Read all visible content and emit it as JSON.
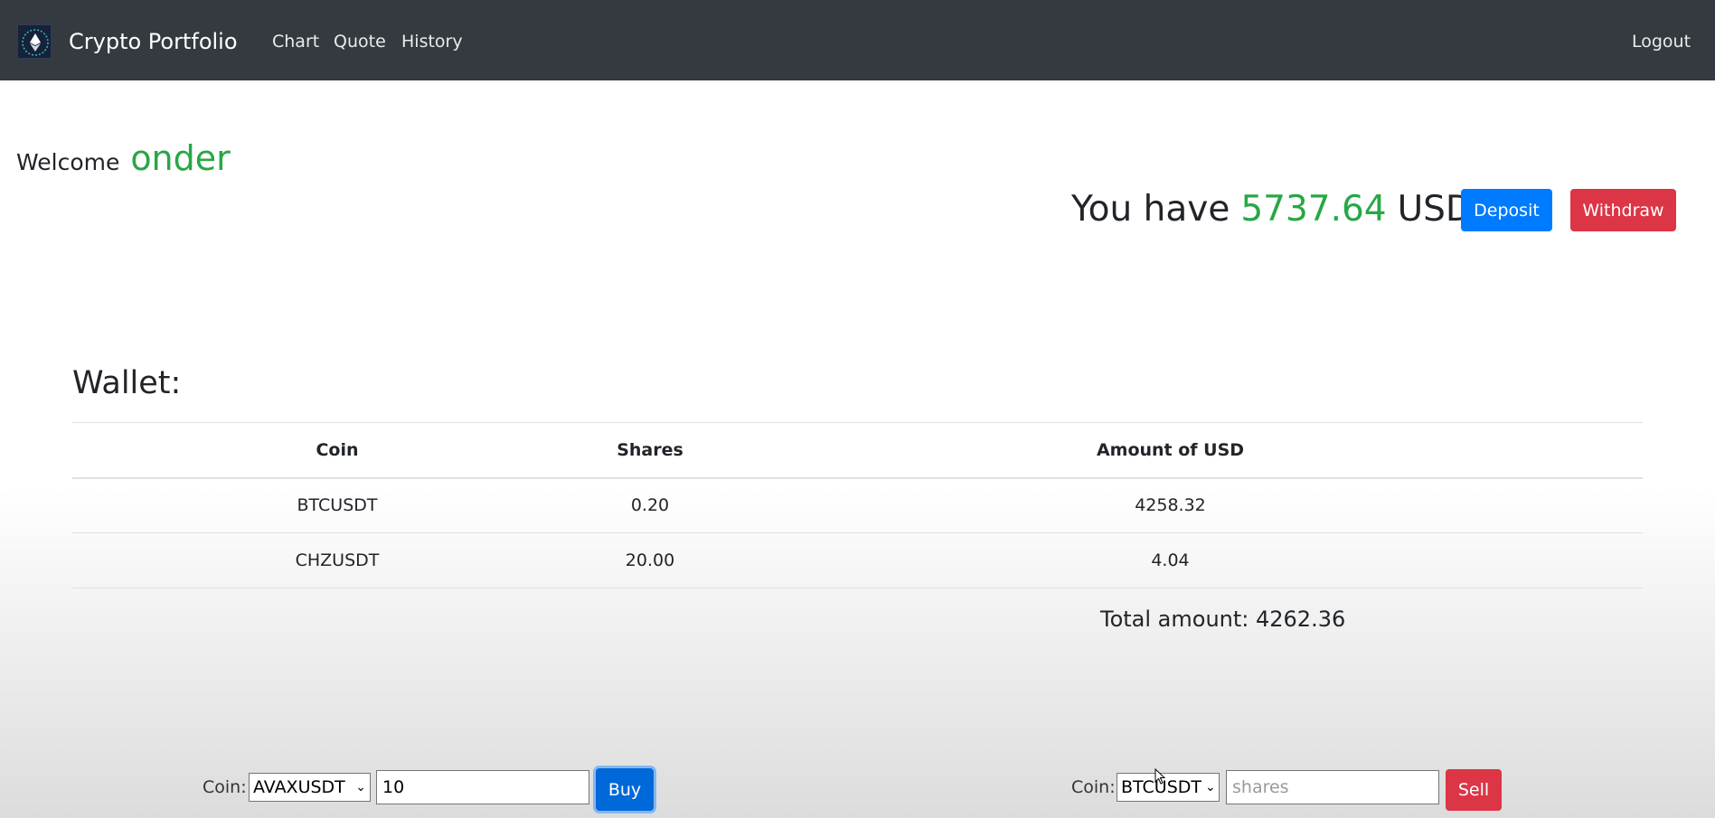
{
  "navbar": {
    "brand": "Crypto Portfolio",
    "links": {
      "chart": "Chart",
      "quote": "Quote",
      "history": "History"
    },
    "logout": "Logout"
  },
  "welcome": {
    "prefix": "Welcome",
    "username": "onder"
  },
  "balance": {
    "prefix": "You have",
    "amount": "5737.64",
    "currency": "USD"
  },
  "actions": {
    "deposit": "Deposit",
    "withdraw": "Withdraw"
  },
  "wallet": {
    "title": "Wallet:",
    "columns": {
      "coin": "Coin",
      "shares": "Shares",
      "amount": "Amount of USD"
    },
    "rows": [
      {
        "coin": "BTCUSDT",
        "shares": "0.20",
        "amount": "4258.32"
      },
      {
        "coin": "CHZUSDT",
        "shares": "20.00",
        "amount": "4.04"
      }
    ],
    "total": "Total amount: 4262.36"
  },
  "buy_form": {
    "label": "Coin:",
    "selected_coin": "AVAXUSDT",
    "quantity": "10",
    "button": "Buy"
  },
  "sell_form": {
    "label": "Coin:",
    "selected_coin": "BTCUSDT",
    "placeholder": "shares",
    "button": "Sell"
  },
  "colors": {
    "navbar": "#343a40",
    "green": "#28a745",
    "deposit": "#007bff",
    "withdraw": "#dc3545"
  }
}
